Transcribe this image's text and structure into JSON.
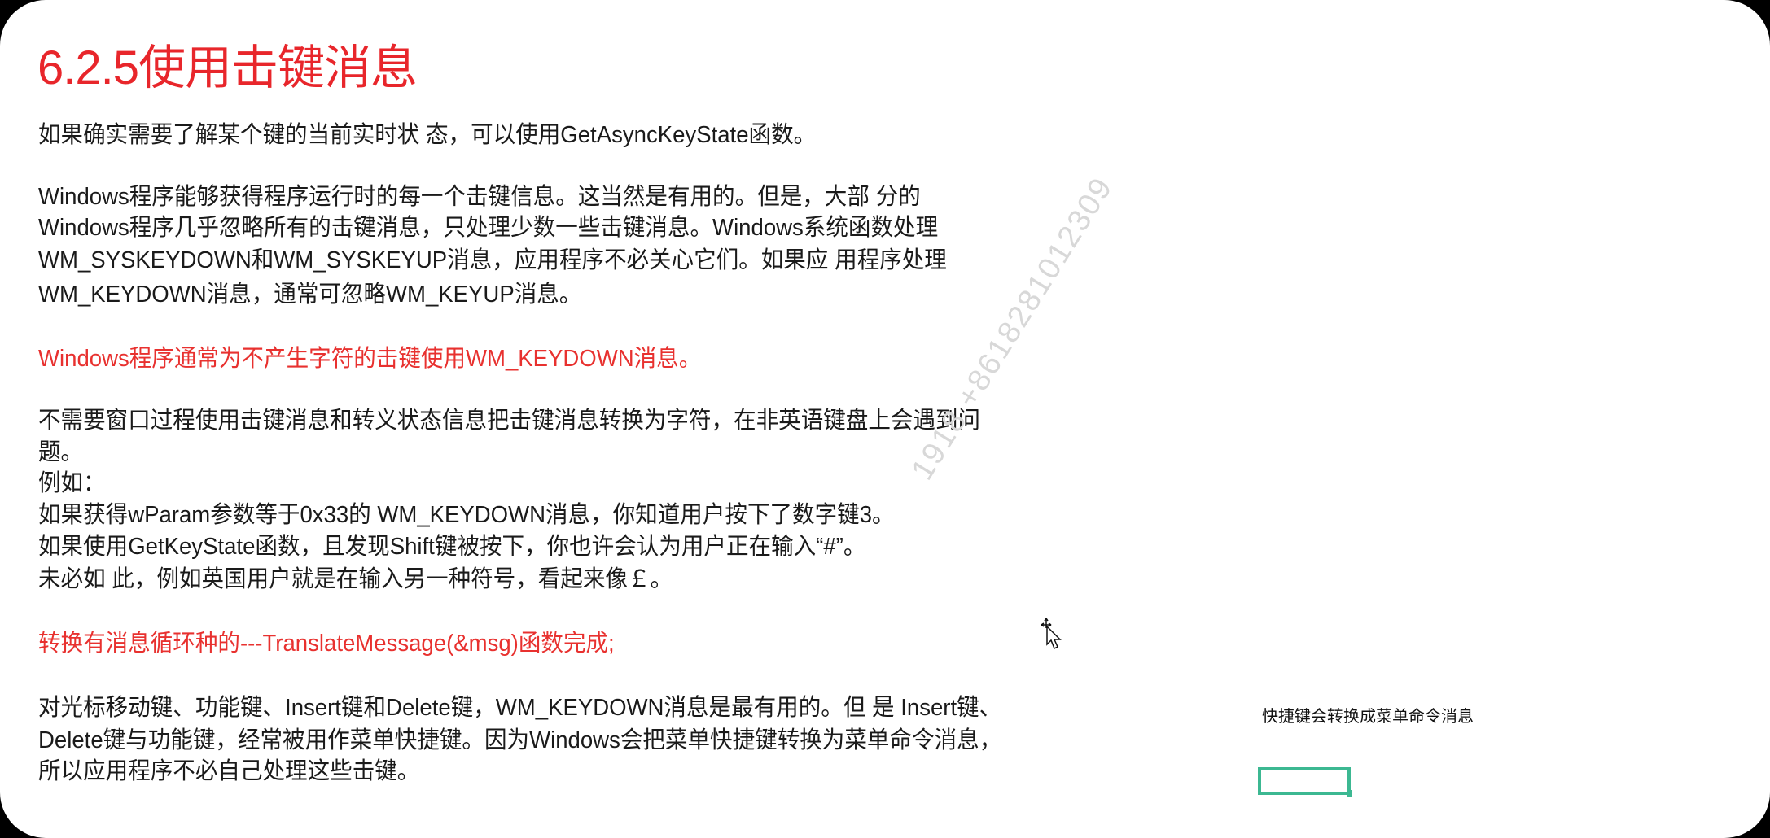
{
  "title": "6.2.5使用击键消息",
  "lines": [
    {
      "text": "如果确实需要了解某个键的当前实时状 态，可以使用GetAsyncKeyState函数。",
      "color": "#1a1a1a"
    },
    {
      "text": "Windows程序能够获得程序运行时的每一个击键信息。这当然是有用的。但是，大部 分的",
      "color": "#1a1a1a"
    },
    {
      "text": "Windows程序几乎忽略所有的击键消息，只处理少数一些击键消息。Windows系统函数处理",
      "color": "#1a1a1a"
    },
    {
      "text": "WM_SYSKEYDOWN和WM_SYSKEYUP消息，应用程序不必关心它们。如果应 用程序处理",
      "color": "#1a1a1a"
    },
    {
      "text": "WM_KEYDOWN消息，通常可忽略WM_KEYUP消息。",
      "color": "#1a1a1a"
    },
    {
      "text": "Windows程序通常为不产生字符的击键使用WM_KEYDOWN消息。",
      "color": "#e8312f"
    },
    {
      "text": "不需要窗口过程使用击键消息和转义状态信息把击键消息转换为字符，在非英语键盘上会遇到问",
      "color": "#1a1a1a"
    },
    {
      "text": "题。",
      "color": "#1a1a1a"
    },
    {
      "text": "例如：",
      "color": "#1a1a1a"
    },
    {
      "text": "如果获得wParam参数等于0x33的 WM_KEYDOWN消息，你知道用户按下了数字键3。",
      "color": "#1a1a1a"
    },
    {
      "text": "如果使用GetKeyState函数，且发现Shift键被按下，你也许会认为用户正在输入“#”。",
      "color": "#1a1a1a"
    },
    {
      "text": "未必如 此，例如英国用户就是在输入另一种符号，看起来像￡。",
      "color": "#1a1a1a"
    },
    {
      "text": "转换有消息循环种的---TranslateMessage(&msg)函数完成;",
      "color": "#e8312f"
    },
    {
      "text": "对光标移动键、功能键、Insert键和Delete键，WM_KEYDOWN消息是最有用的。但 是 Insert键、",
      "color": "#1a1a1a"
    },
    {
      "text": "Delete键与功能键，经常被用作菜单快捷键。因为Windows会把菜单快捷键转换为菜单命令消息，",
      "color": "#1a1a1a"
    },
    {
      "text": "所以应用程序不必自己处理这些击键。",
      "color": "#1a1a1a"
    }
  ],
  "note": "快捷键会转换成菜单命令消息",
  "watermark": "1918 +8618281012309",
  "colors": {
    "title": "#e8262b",
    "highlight_box": "#3cb892"
  },
  "cursor_icon": "move-arrow-cursor"
}
